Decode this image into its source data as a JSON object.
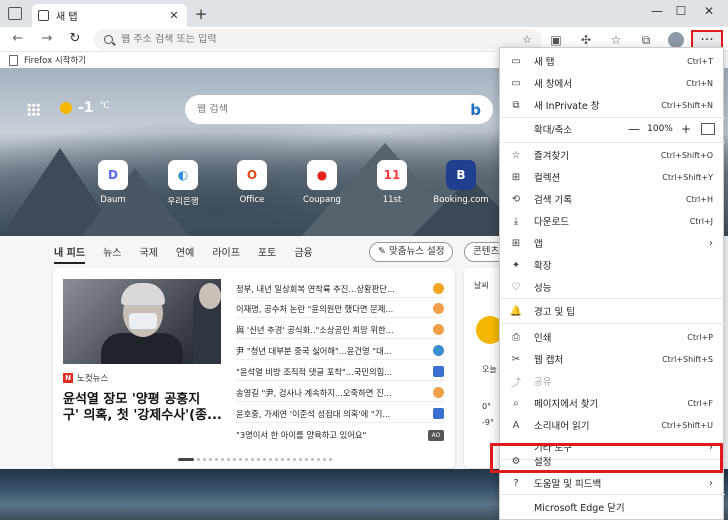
{
  "tab": {
    "title": "새 탭",
    "close": "✕",
    "new": "+"
  },
  "window": {
    "minimize": "—",
    "maximize": "☐",
    "close": "✕"
  },
  "address": {
    "placeholder": "웹 주소 검색 또는 입력"
  },
  "toolbar": {
    "more": "···"
  },
  "favorites": {
    "item": "Firefox 시작하기"
  },
  "hero": {
    "weather_temp": "-1",
    "weather_unit": "℃",
    "search_placeholder": "웹 검색",
    "bing": "b"
  },
  "quicklinks": [
    {
      "label": "Daum",
      "glyph": "D",
      "color": "#5b6bf0"
    },
    {
      "label": "우리은행",
      "glyph": "◐",
      "color": "#2a8fd6"
    },
    {
      "label": "Office",
      "glyph": "O",
      "color": "#e64a19"
    },
    {
      "label": "Coupang",
      "glyph": "●",
      "color": "#e0231b"
    },
    {
      "label": "11st",
      "glyph": "11",
      "color": "#ff3b3b"
    },
    {
      "label": "Booking.com",
      "glyph": "B",
      "color": "#1f3f8f"
    }
  ],
  "feed": {
    "tabs": [
      "내 피드",
      "뉴스",
      "국제",
      "연예",
      "라이프",
      "포토",
      "금융"
    ],
    "personalize": "맞춤뉴스 설정",
    "settings_pill": "콘텐츠"
  },
  "news": {
    "source": "노컷뉴스",
    "source_logo": "N",
    "headline_lines": [
      "윤석열 장모 '양평 공흥지",
      "구' 의혹, 첫 '강제수사'(종..."
    ],
    "items": [
      {
        "text": "정부, 내년 일상회복 연착륙 추진...상황판단...",
        "color": "#f5a623"
      },
      {
        "text": "이재명, 공수처 논란 \"윤의원만 했다면 문제...",
        "color": "#f0a04b"
      },
      {
        "text": "與 '신년 추경' 공식화..\"소상공인 희망 위한...",
        "color": "#f0a04b"
      },
      {
        "text": "尹 \"청년 대부분 중국 싫어해\"...윤건영 \"대...",
        "color": "#3a8fd1"
      },
      {
        "text": "\"윤석열 비방 조직적 댓글 포착\"...국민의힘...",
        "color": "#3a6fd1"
      },
      {
        "text": "송영길 \"尹, 검사나 계속하지...오죽하면 진...",
        "color": "#f0a04b"
      },
      {
        "text": "윤호중, 가세연 '이준석 성접대 의혹'에 \"기...",
        "color": "#3a6fd1"
      },
      {
        "text": "\"3명이서 한 아이를 양육하고 있어요\"",
        "color": "#555"
      }
    ],
    "last_badge": "AO"
  },
  "weather_card": {
    "label": "날씨",
    "temp1": "0°",
    "temp2": "-9°",
    "morning": "오늘"
  },
  "menu": {
    "items": [
      {
        "label": "새 탭",
        "shortcut": "Ctrl+T",
        "icon": "tab-icon",
        "glyph": "▭"
      },
      {
        "label": "새 창에서",
        "shortcut": "Ctrl+N",
        "icon": "window-icon",
        "glyph": "▭"
      },
      {
        "label": "새 InPrivate 창",
        "shortcut": "Ctrl+Shift+N",
        "icon": "inprivate-icon",
        "glyph": "⧉"
      },
      {
        "label": "즐겨찾기",
        "shortcut": "Ctrl+Shift+O",
        "icon": "favorites-icon",
        "glyph": "☆"
      },
      {
        "label": "컬렉션",
        "shortcut": "Ctrl+Shift+Y",
        "icon": "collections-icon",
        "glyph": "⊞"
      },
      {
        "label": "검색 기록",
        "shortcut": "Ctrl+H",
        "icon": "history-icon",
        "glyph": "⟲"
      },
      {
        "label": "다운로드",
        "shortcut": "Ctrl+J",
        "icon": "download-icon",
        "glyph": "⤓"
      },
      {
        "label": "앱",
        "shortcut": "",
        "icon": "apps-icon",
        "glyph": "⊞",
        "arrow": "›"
      },
      {
        "label": "확장",
        "shortcut": "",
        "icon": "extensions-icon",
        "glyph": "✦"
      },
      {
        "label": "성능",
        "shortcut": "",
        "icon": "performance-icon",
        "glyph": "♡"
      },
      {
        "label": "경고 및 팁",
        "shortcut": "",
        "icon": "bell-icon",
        "glyph": "🔔"
      },
      {
        "label": "인쇄",
        "shortcut": "Ctrl+P",
        "icon": "print-icon",
        "glyph": "⎙"
      },
      {
        "label": "웹 캡처",
        "shortcut": "Ctrl+Shift+S",
        "icon": "capture-icon",
        "glyph": "✂"
      },
      {
        "label": "공유",
        "shortcut": "",
        "icon": "share-icon",
        "glyph": "⤴",
        "disabled": true
      },
      {
        "label": "페이지에서 찾기",
        "shortcut": "Ctrl+F",
        "icon": "find-icon",
        "glyph": "⌕"
      },
      {
        "label": "소리내어 읽기",
        "shortcut": "Ctrl+Shift+U",
        "icon": "read-aloud-icon",
        "glyph": "A"
      },
      {
        "label": "기타 도구",
        "shortcut": "",
        "icon": "",
        "glyph": "",
        "arrow": "›"
      },
      {
        "label": "설정",
        "shortcut": "",
        "icon": "gear-icon",
        "glyph": "⚙"
      },
      {
        "label": "도움말 및 피드백",
        "shortcut": "",
        "icon": "help-icon",
        "glyph": "?",
        "arrow": "›"
      },
      {
        "label": "Microsoft Edge 닫기",
        "shortcut": "",
        "icon": "",
        "glyph": ""
      }
    ],
    "zoom": {
      "label": "확대/축소",
      "value": "100%",
      "minus": "—",
      "plus": "+"
    }
  },
  "colors": {
    "highlight": "#e11b1b",
    "bing": "#1f6fc5"
  }
}
